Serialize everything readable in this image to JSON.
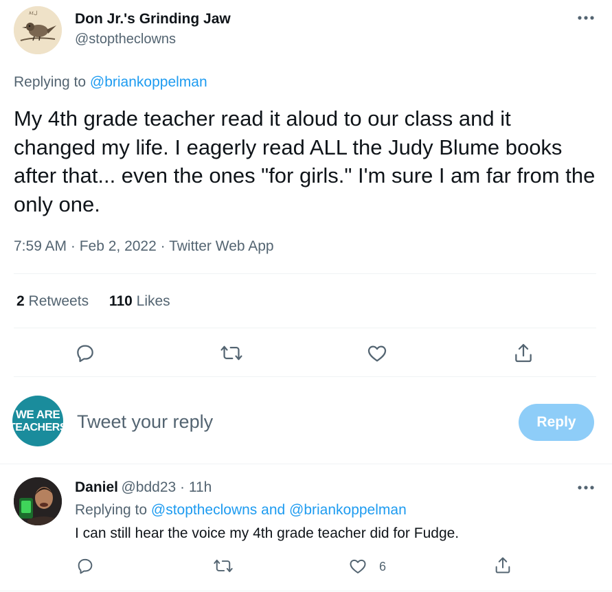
{
  "tweet": {
    "author_name": "Don Jr.'s Grinding Jaw",
    "author_handle": "@stoptheclowns",
    "replying_prefix": "Replying to",
    "replying_to": "@briankoppelman",
    "text": "My 4th grade teacher read it aloud to our class and it changed my life. I eagerly read ALL the Judy Blume books after that... even the ones \"for girls.\" I'm sure I am far from the only one.",
    "meta": "7:59 AM · Feb 2, 2022 · Twitter Web App",
    "retweets_count": "2",
    "retweets_label": "Retweets",
    "likes_count": "110",
    "likes_label": "Likes"
  },
  "composer": {
    "avatar_line1": "WE ARE",
    "avatar_line2": "TEACHERS",
    "placeholder": "Tweet your reply",
    "reply_button": "Reply"
  },
  "reply": {
    "name": "Daniel",
    "handle_time": "@bdd23 · 11h",
    "replying_prefix": "Replying to",
    "replying_to": "@stoptheclowns and @briankoppelman",
    "text": "I can still hear the voice my 4th grade teacher did for Fudge.",
    "like_count": "6"
  },
  "icons": {
    "more": "more-horizontal-icon",
    "reply": "comment-bubble-icon",
    "retweet": "retweet-arrows-icon",
    "like": "heart-icon",
    "share": "share-upload-icon"
  },
  "colors": {
    "accent": "#1d9bf0",
    "reply_button_disabled": "#8ecdf8",
    "secondary_text": "#536471",
    "primary_text": "#0f1419",
    "divider": "#eff3f4",
    "we_are_teachers_bg": "#1a8c9c"
  }
}
